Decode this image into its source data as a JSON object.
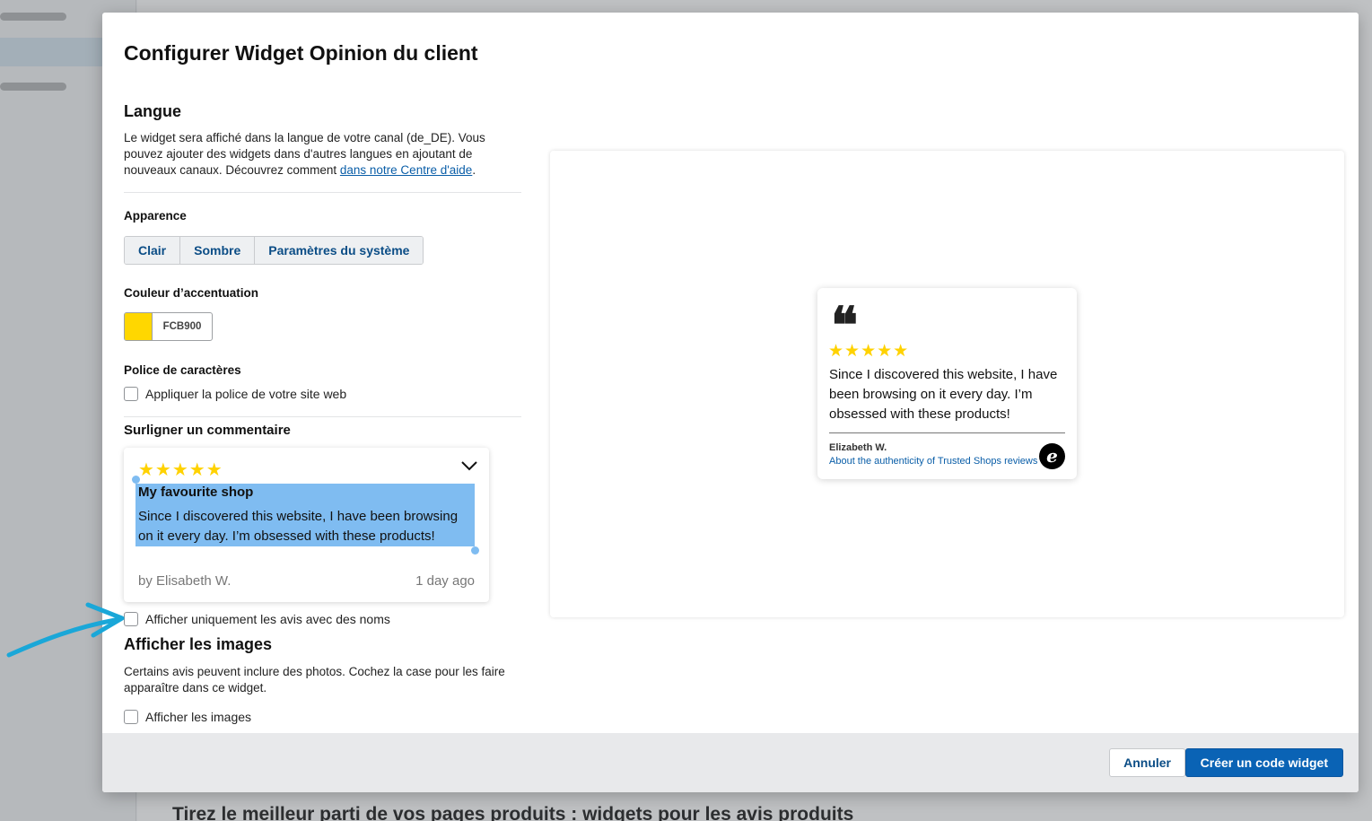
{
  "background": {
    "heading": "Tirez le meilleur parti de vos pages produits : widgets pour les avis produits"
  },
  "modal": {
    "title": "Configurer Widget Opinion du client"
  },
  "language": {
    "heading": "Langue",
    "text": "Le widget sera affiché dans la langue de votre canal (de_DE). Vous pouvez ajouter des widgets dans d'autres langues en ajoutant de nouveaux canaux. Découvrez comment ",
    "link": "dans notre Centre d'aide",
    "after_link": "."
  },
  "appearance": {
    "label": "Apparence",
    "options": [
      "Clair",
      "Sombre",
      "Paramètres du système"
    ]
  },
  "accent": {
    "label": "Couleur d’accentuation",
    "hex": "FCB900",
    "swatch_color": "#ffd700"
  },
  "font": {
    "label": "Police de caractères",
    "checkbox": "Appliquer la police de votre site web"
  },
  "highlight": {
    "label": "Surligner un commentaire",
    "stars": "★★★★★",
    "title": "My favourite shop",
    "body": "Since I discovered this website, I have been browsing on it every day. I’m obsessed with these products!",
    "author": "by Elisabeth W.",
    "time": "1 day ago",
    "names_only": "Afficher uniquement les avis avec des noms"
  },
  "images": {
    "heading": "Afficher les images",
    "text": "Certains avis peuvent inclure des photos. Cochez la case pour les faire apparaître dans ce widget.",
    "checkbox": "Afficher les images"
  },
  "preview": {
    "quote": "❝",
    "stars": "★★★★★",
    "text": "Since I discovered this website, I have been browsing on it every day. I’m obsessed with these products!",
    "author": "Elizabeth W.",
    "authenticity": "About the authenticity of Trusted Shops reviews",
    "logo": "e"
  },
  "footer": {
    "cancel": "Annuler",
    "create": "Créer un code widget"
  },
  "colors": {
    "star": "#ffd200",
    "primary": "#0a63b5",
    "highlight": "#7fbcf1",
    "arrow": "#1aa7d8"
  }
}
